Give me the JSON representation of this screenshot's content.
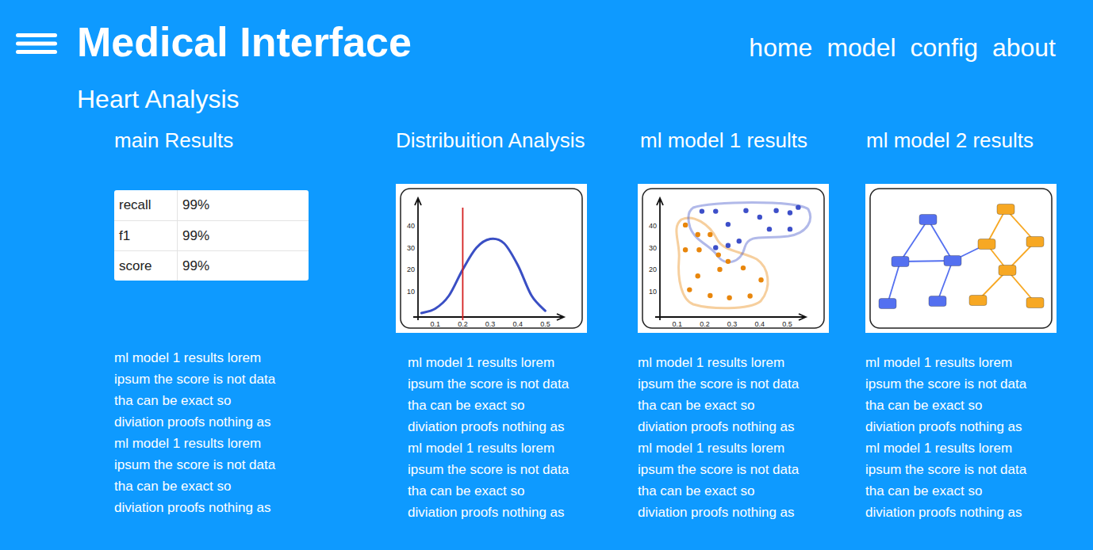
{
  "header": {
    "title": "Medical Interface",
    "nav": [
      {
        "label": "home"
      },
      {
        "label": "model"
      },
      {
        "label": "config"
      },
      {
        "label": "about"
      }
    ]
  },
  "page": {
    "title": "Heart Analysis"
  },
  "sections": [
    {
      "kind": "table",
      "heading": "main Results",
      "rows": [
        [
          "recall",
          "99%"
        ],
        [
          "f1",
          "99%"
        ],
        [
          "score",
          "99%"
        ]
      ],
      "lines": [
        "ml model 1 results lorem",
        "ipsum the score is not data",
        "tha can be exact so",
        "diviation proofs nothing as",
        "ml model 1 results lorem",
        "ipsum the score is not data",
        "tha can be exact so",
        "diviation proofs nothing as"
      ]
    },
    {
      "kind": "line",
      "heading": "Distribuition Analysis",
      "chart": {
        "x_ticks": [
          "0.1",
          "0.2",
          "0.3",
          "0.4",
          "0.5"
        ],
        "y_ticks": [
          "10",
          "20",
          "30",
          "40"
        ],
        "x": [
          0.05,
          0.1,
          0.15,
          0.2,
          0.25,
          0.3,
          0.35,
          0.4,
          0.45,
          0.5
        ],
        "values": [
          0,
          2,
          8,
          20,
          30,
          34,
          32,
          22,
          8,
          1
        ],
        "marker": 0.2
      },
      "lines": [
        "ml model 1 results lorem",
        "ipsum the score is not data",
        "tha can be exact so",
        "diviation proofs nothing as",
        "ml model 1 results lorem",
        "ipsum the score is not data",
        "tha can be exact so",
        "diviation proofs nothing as"
      ]
    },
    {
      "kind": "scatter",
      "heading": "ml model 1 results",
      "chart": {
        "x_ticks": [
          "0.1",
          "0.2",
          "0.3",
          "0.4",
          "0.5"
        ],
        "y_ticks": [
          "10",
          "20",
          "30",
          "40"
        ],
        "series": [
          {
            "color": "#3d4fc9",
            "points": [
              [
                0.19,
                46.7
              ],
              [
                0.24,
                46.7
              ],
              [
                0.285,
                40.7
              ],
              [
                0.35,
                47
              ],
              [
                0.4,
                44
              ],
              [
                0.46,
                47
              ],
              [
                0.51,
                46
              ],
              [
                0.54,
                48.5
              ],
              [
                0.435,
                38.5
              ],
              [
                0.51,
                38.5
              ],
              [
                0.24,
                30
              ],
              [
                0.285,
                31
              ],
              [
                0.325,
                33
              ]
            ]
          },
          {
            "color": "#e8860c",
            "points": [
              [
                0.13,
                40.4
              ],
              [
                0.175,
                36
              ],
              [
                0.22,
                36
              ],
              [
                0.13,
                29
              ],
              [
                0.18,
                29
              ],
              [
                0.25,
                26.7
              ],
              [
                0.285,
                23.7
              ],
              [
                0.175,
                17
              ],
              [
                0.255,
                20
              ],
              [
                0.34,
                20.7
              ],
              [
                0.405,
                15.2
              ],
              [
                0.145,
                10.7
              ],
              [
                0.22,
                8
              ],
              [
                0.29,
                7
              ],
              [
                0.365,
                7.8
              ]
            ]
          }
        ]
      },
      "lines": [
        "ml model 1 results lorem",
        "ipsum the score is not data",
        "tha can be exact so",
        "diviation proofs nothing as",
        "ml model 1 results lorem",
        "ipsum the score is not data",
        "tha can be exact so",
        "diviation proofs nothing as"
      ]
    },
    {
      "kind": "graph",
      "heading": "ml model 2 results",
      "graph": {
        "nodes": [
          {
            "color": "#5470f0"
          },
          {
            "color": "#5470f0"
          },
          {
            "color": "#5470f0"
          },
          {
            "color": "#5470f0"
          },
          {
            "color": "#5470f0"
          },
          {
            "color": "#f7a823"
          },
          {
            "color": "#f7a823"
          },
          {
            "color": "#f7a823"
          },
          {
            "color": "#f7a823"
          },
          {
            "color": "#f7a823"
          },
          {
            "color": "#f7a823"
          }
        ],
        "edges": [
          [
            0,
            1
          ],
          [
            0,
            2
          ],
          [
            1,
            2
          ],
          [
            1,
            3
          ],
          [
            2,
            4
          ],
          [
            2,
            6
          ],
          [
            5,
            6
          ],
          [
            5,
            7
          ],
          [
            6,
            8
          ],
          [
            7,
            8
          ],
          [
            8,
            9
          ],
          [
            8,
            10
          ]
        ]
      },
      "lines": [
        "ml model 1 results lorem",
        "ipsum the score is not data",
        "tha can be exact so",
        "diviation proofs nothing as",
        "ml model 1 results lorem",
        "ipsum the score is not data",
        "tha can be exact so",
        "diviation proofs nothing as"
      ]
    }
  ]
}
